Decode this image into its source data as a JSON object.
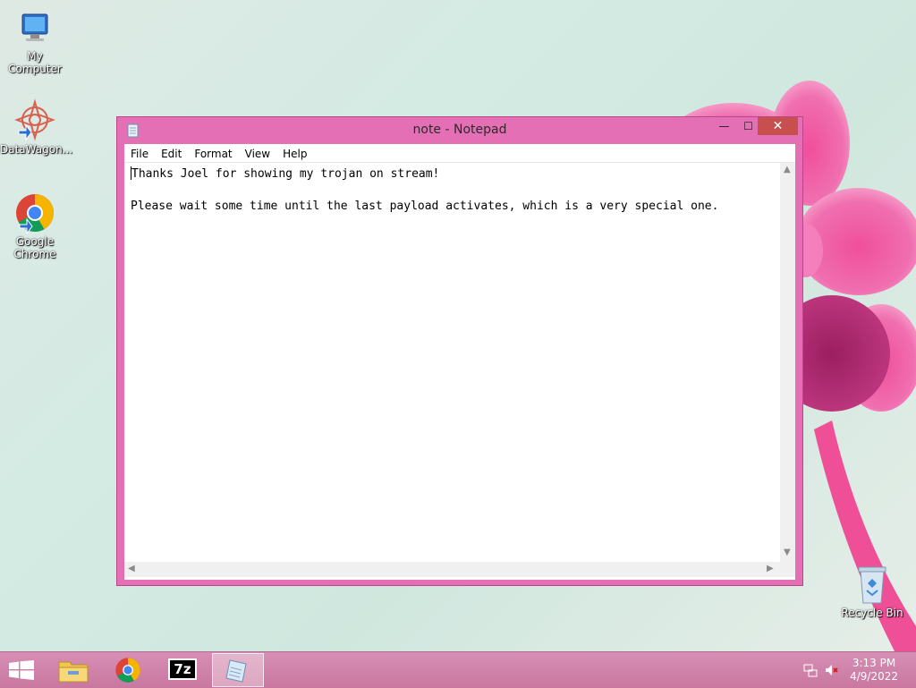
{
  "desktop": {
    "icons": [
      {
        "label": "My Computer"
      },
      {
        "label": "DataWagon..."
      },
      {
        "label": "Google Chrome"
      },
      {
        "label": "Recycle Bin"
      }
    ]
  },
  "window": {
    "title": "note - Notepad",
    "buttons": {
      "minimize": "—",
      "maximize": "☐",
      "close": "✕"
    },
    "menu": [
      "File",
      "Edit",
      "Format",
      "View",
      "Help"
    ],
    "content": {
      "line1": "Thanks Joel for showing my trojan on stream!",
      "line2": "",
      "line3": "Please wait some time until the last payload activates, which is a very special one."
    }
  },
  "taskbar": {
    "pinned": [
      {
        "icon": "file-explorer-icon"
      },
      {
        "icon": "chrome-icon"
      },
      {
        "icon": "7zip-icon",
        "label": "7z"
      },
      {
        "icon": "notepad-icon"
      }
    ],
    "tray": {
      "time": "3:13 PM",
      "date": "4/9/2022"
    }
  },
  "colors": {
    "accent": "#e56fb4",
    "taskbar": "#cf83ab",
    "close": "#c7504f"
  }
}
